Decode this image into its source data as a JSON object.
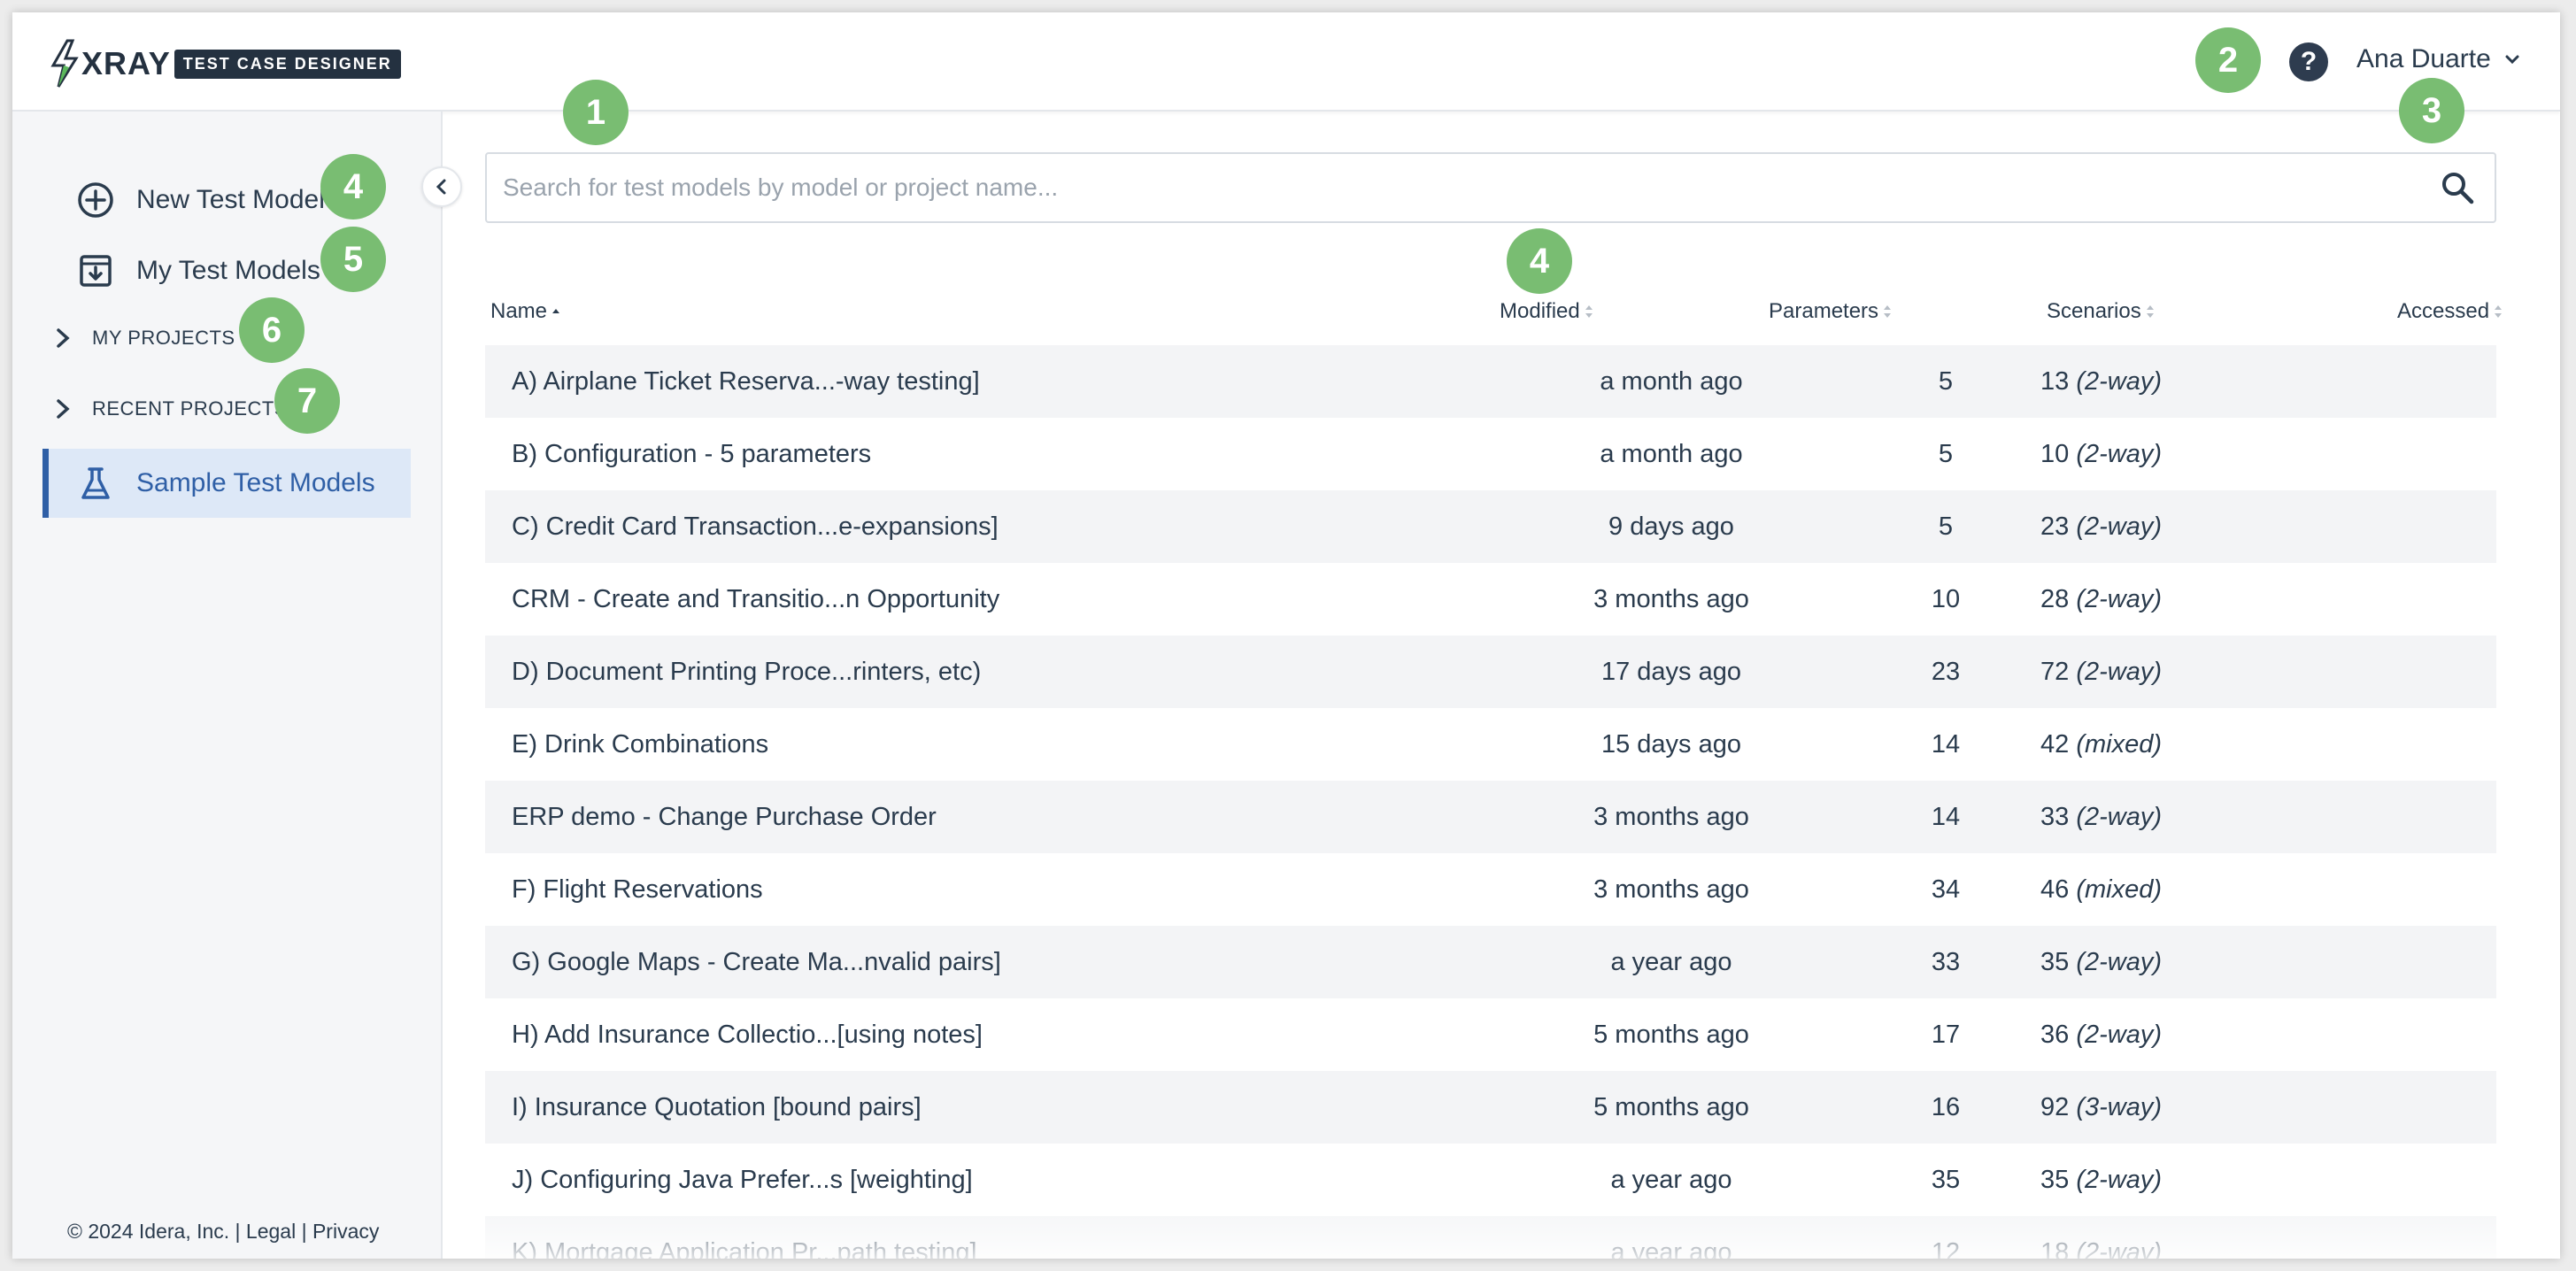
{
  "header": {
    "logo_main": "XRAY",
    "logo_tag": "TEST CASE DESIGNER",
    "help_glyph": "?",
    "user_name": "Ana Duarte"
  },
  "sidebar": {
    "items": [
      {
        "label": "New Test Model",
        "icon": "plus-circle-icon"
      },
      {
        "label": "My Test Models",
        "icon": "download-box-icon"
      }
    ],
    "sections": [
      {
        "label": "MY PROJECTS"
      },
      {
        "label": "RECENT PROJECTS"
      }
    ],
    "active": {
      "label": "Sample Test Models",
      "icon": "flask-icon"
    },
    "footer": "© 2024 Idera, Inc. | Legal | Privacy"
  },
  "search": {
    "placeholder": "Search for test models by model or project name...",
    "value": ""
  },
  "table": {
    "columns": {
      "name": "Name",
      "modified": "Modified",
      "parameters": "Parameters",
      "scenarios": "Scenarios",
      "accessed": "Accessed"
    },
    "rows": [
      {
        "name": "A) Airplane Ticket Reserva...-way testing]",
        "modified": "a month ago",
        "parameters": "5",
        "scenarios": "13",
        "way": "(2-way)"
      },
      {
        "name": "B) Configuration - 5 parameters",
        "modified": "a month ago",
        "parameters": "5",
        "scenarios": "10",
        "way": "(2-way)"
      },
      {
        "name": "C) Credit Card Transaction...e-expansions]",
        "modified": "9 days ago",
        "parameters": "5",
        "scenarios": "23",
        "way": "(2-way)"
      },
      {
        "name": "CRM - Create and Transitio...n Opportunity",
        "modified": "3 months ago",
        "parameters": "10",
        "scenarios": "28",
        "way": "(2-way)"
      },
      {
        "name": "D) Document Printing Proce...rinters, etc)",
        "modified": "17 days ago",
        "parameters": "23",
        "scenarios": "72",
        "way": "(2-way)"
      },
      {
        "name": "E) Drink Combinations",
        "modified": "15 days ago",
        "parameters": "14",
        "scenarios": "42",
        "way": "(mixed)"
      },
      {
        "name": "ERP demo - Change Purchase Order",
        "modified": "3 months ago",
        "parameters": "14",
        "scenarios": "33",
        "way": "(2-way)"
      },
      {
        "name": "F) Flight Reservations",
        "modified": "3 months ago",
        "parameters": "34",
        "scenarios": "46",
        "way": "(mixed)"
      },
      {
        "name": "G) Google Maps - Create Ma...nvalid pairs]",
        "modified": "a year ago",
        "parameters": "33",
        "scenarios": "35",
        "way": "(2-way)"
      },
      {
        "name": "H) Add Insurance Collectio...[using notes]",
        "modified": "5 months ago",
        "parameters": "17",
        "scenarios": "36",
        "way": "(2-way)"
      },
      {
        "name": "I) Insurance Quotation [bound pairs]",
        "modified": "5 months ago",
        "parameters": "16",
        "scenarios": "92",
        "way": "(3-way)"
      },
      {
        "name": "J) Configuring Java Prefer...s [weighting]",
        "modified": "a year ago",
        "parameters": "35",
        "scenarios": "35",
        "way": "(2-way)"
      },
      {
        "name": "K) Mortgage Application Pr...path testing]",
        "modified": "a year ago",
        "parameters": "12",
        "scenarios": "18",
        "way": "(2-way)"
      }
    ]
  },
  "annotations": [
    "1",
    "2",
    "3",
    "4",
    "5",
    "6",
    "7",
    "4"
  ]
}
